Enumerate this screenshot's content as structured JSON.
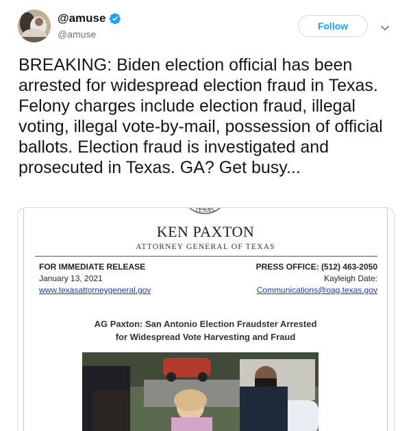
{
  "tweet": {
    "display_name": "@amuse",
    "handle": "@amuse",
    "follow_label": "Follow",
    "text": "BREAKING: Biden election official has been arrested for widespread election fraud in Texas. Felony charges include election fraud, illegal voting, illegal vote-by-mail, possession of official ballots. Election fraud is investigated and prosecuted in Texas. GA? Get busy..."
  },
  "document": {
    "seal_text": "TEXAS",
    "title": "KEN PAXTON",
    "subtitle": "ATTORNEY GENERAL OF TEXAS",
    "release_label": "FOR IMMEDIATE RELEASE",
    "date": "January 13, 2021",
    "website": "www.texasattorneygeneral.gov",
    "press_office": "PRESS OFFICE: (512) 463-2050",
    "contact": "Kayleigh Date:",
    "email": "Communications@oag.texas.gov",
    "headline_line1": "AG Paxton: San Antonio Election Fraudster Arrested",
    "headline_line2": "for Widespread Vote Harvesting and Fraud"
  },
  "colors": {
    "accent": "#1da1f2",
    "text": "#14171a",
    "secondary": "#657786",
    "link": "#1a3e9f"
  },
  "icons": [
    "verified-badge-icon",
    "chevron-down-icon"
  ]
}
